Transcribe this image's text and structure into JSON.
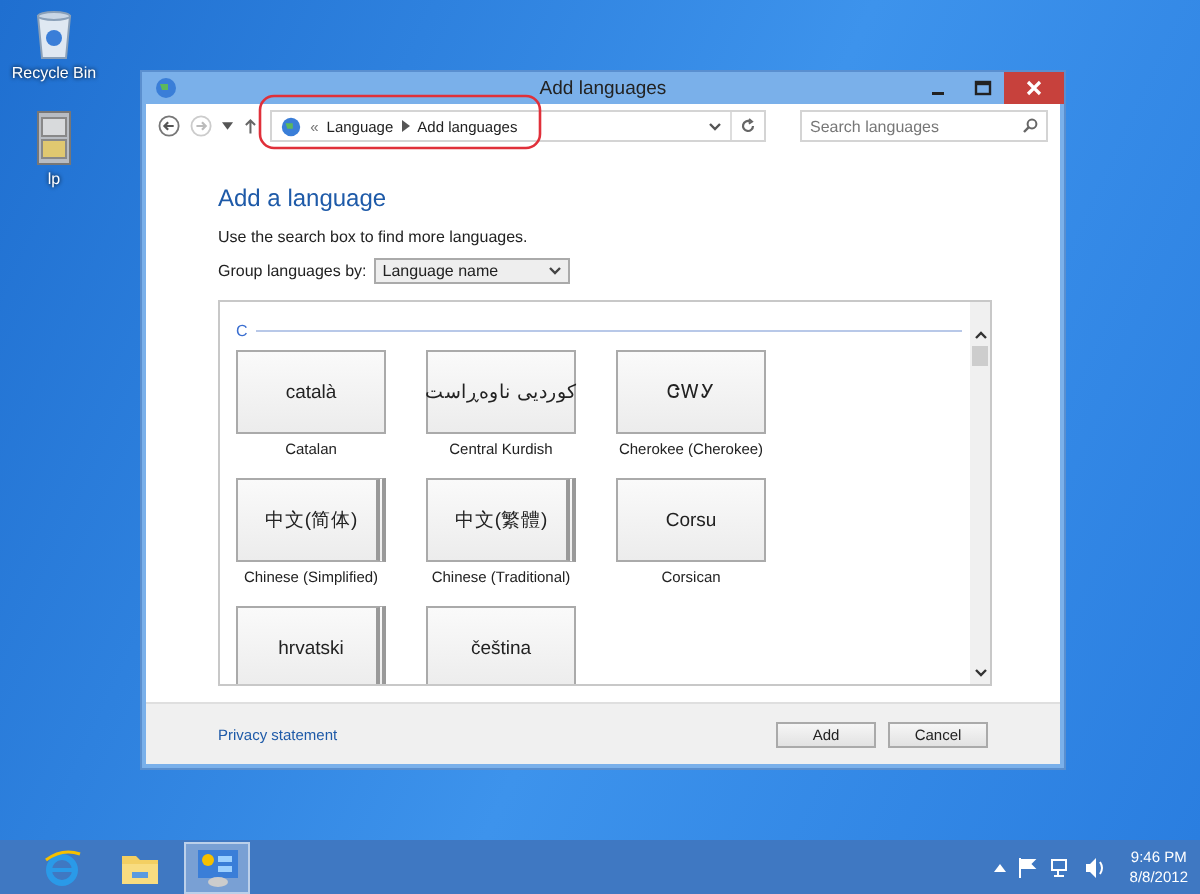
{
  "desktop_icons": [
    {
      "label": "Recycle Bin",
      "kind": "recycle"
    },
    {
      "label": "lp",
      "kind": "cabinet"
    }
  ],
  "window": {
    "title": "Add languages",
    "address": {
      "overflow": "«",
      "breadcrumb": [
        "Language",
        "Add languages"
      ]
    },
    "search": {
      "placeholder": "Search languages"
    },
    "heading": "Add a language",
    "instruction": "Use the search box to find more languages.",
    "group_by": {
      "label": "Group languages by:",
      "value": "Language name"
    },
    "section": "C",
    "languages": [
      {
        "native": "català",
        "name": "Catalan",
        "stacked": false
      },
      {
        "native": "کوردیی ناوەڕاست",
        "name": "Central Kurdish",
        "stacked": false
      },
      {
        "native": "ᏣᎳᎩ",
        "name": "Cherokee (Cherokee)",
        "stacked": false
      },
      {
        "native": "中文(简体)",
        "name": "Chinese (Simplified)",
        "stacked": true
      },
      {
        "native": "中文(繁體)",
        "name": "Chinese (Traditional)",
        "stacked": true
      },
      {
        "native": "Corsu",
        "name": "Corsican",
        "stacked": false
      },
      {
        "native": "hrvatski",
        "stacked": true
      },
      {
        "native": "čeština",
        "stacked": false
      }
    ],
    "privacy_link": "Privacy statement",
    "buttons": [
      "Add",
      "Cancel"
    ]
  },
  "taskbar": {
    "apps": [
      {
        "kind": "browser",
        "selected": false
      },
      {
        "kind": "folder",
        "selected": false
      },
      {
        "kind": "control-panel",
        "selected": true
      }
    ],
    "time": "9:46 PM",
    "date": "8/8/2012"
  }
}
